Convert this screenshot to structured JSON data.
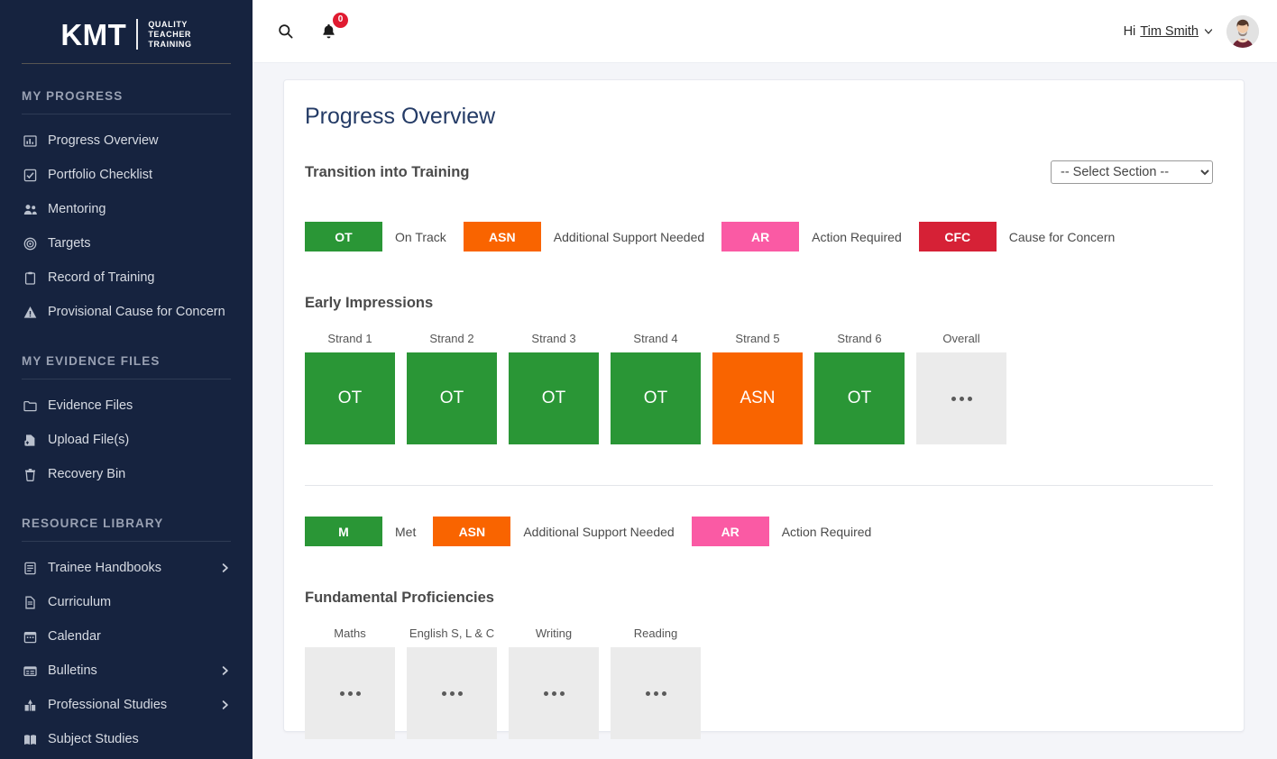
{
  "sidebar": {
    "logo": {
      "main": "KMT",
      "line1": "QUALITY",
      "line2": "TEACHER",
      "line3": "TRAINING"
    },
    "sections": [
      {
        "title": "MY PROGRESS",
        "items": [
          {
            "label": "Progress Overview",
            "icon": "bar-chart-icon",
            "chevron": false
          },
          {
            "label": "Portfolio Checklist",
            "icon": "checkbox-icon",
            "chevron": false
          },
          {
            "label": "Mentoring",
            "icon": "users-icon",
            "chevron": false
          },
          {
            "label": "Targets",
            "icon": "target-icon",
            "chevron": false
          },
          {
            "label": "Record of Training",
            "icon": "clipboard-icon",
            "chevron": false
          },
          {
            "label": "Provisional Cause for Concern",
            "icon": "warning-icon",
            "chevron": false
          }
        ]
      },
      {
        "title": "MY EVIDENCE FILES",
        "items": [
          {
            "label": "Evidence Files",
            "icon": "folder-icon",
            "chevron": false
          },
          {
            "label": "Upload File(s)",
            "icon": "file-upload-icon",
            "chevron": false
          },
          {
            "label": "Recovery Bin",
            "icon": "trash-icon",
            "chevron": false
          }
        ]
      },
      {
        "title": "RESOURCE LIBRARY",
        "items": [
          {
            "label": "Trainee Handbooks",
            "icon": "book-list-icon",
            "chevron": true
          },
          {
            "label": "Curriculum",
            "icon": "document-icon",
            "chevron": false
          },
          {
            "label": "Calendar",
            "icon": "calendar-icon",
            "chevron": false
          },
          {
            "label": "Bulletins",
            "icon": "table-icon",
            "chevron": true
          },
          {
            "label": "Professional Studies",
            "icon": "chalkboard-icon",
            "chevron": true
          },
          {
            "label": "Subject Studies",
            "icon": "open-book-icon",
            "chevron": false
          }
        ]
      }
    ]
  },
  "topbar": {
    "search_icon": "search-icon",
    "bell_icon": "bell-icon",
    "notification_count": "0",
    "greeting_prefix": "Hi",
    "user_name": "Tim Smith",
    "chevron_icon": "chevron-down-icon",
    "avatar": "user-avatar"
  },
  "main": {
    "page_title": "Progress Overview",
    "section_heading": "Transition into Training",
    "section_select": {
      "selected": "-- Select Section --",
      "options": [
        "-- Select Section --"
      ]
    },
    "legend_top": [
      {
        "code": "OT",
        "text": "On Track",
        "color": "#2a9636"
      },
      {
        "code": "ASN",
        "text": "Additional Support Needed",
        "color": "#f96400"
      },
      {
        "code": "AR",
        "text": "Action Required",
        "color": "#fa5aa4"
      },
      {
        "code": "CFC",
        "text": "Cause for Concern",
        "color": "#d62136"
      }
    ],
    "early_impressions": {
      "heading": "Early Impressions",
      "tiles": [
        {
          "label": "Strand 1",
          "value": "OT",
          "color": "#2a9636",
          "empty": false
        },
        {
          "label": "Strand 2",
          "value": "OT",
          "color": "#2a9636",
          "empty": false
        },
        {
          "label": "Strand 3",
          "value": "OT",
          "color": "#2a9636",
          "empty": false
        },
        {
          "label": "Strand 4",
          "value": "OT",
          "color": "#2a9636",
          "empty": false
        },
        {
          "label": "Strand 5",
          "value": "ASN",
          "color": "#f96400",
          "empty": false
        },
        {
          "label": "Strand 6",
          "value": "OT",
          "color": "#2a9636",
          "empty": false
        },
        {
          "label": "Overall",
          "value": "",
          "color": "#ebebeb",
          "empty": true
        }
      ]
    },
    "legend_bottom": [
      {
        "code": "M",
        "text": "Met",
        "color": "#2a9636"
      },
      {
        "code": "ASN",
        "text": "Additional Support Needed",
        "color": "#f96400"
      },
      {
        "code": "AR",
        "text": "Action Required",
        "color": "#fa5aa4"
      }
    ],
    "fundamental_proficiencies": {
      "heading": "Fundamental Proficiencies",
      "tiles": [
        {
          "label": "Maths",
          "value": "",
          "color": "#ebebeb",
          "empty": true
        },
        {
          "label": "English S, L & C",
          "value": "",
          "color": "#ebebeb",
          "empty": true
        },
        {
          "label": "Writing",
          "value": "",
          "color": "#ebebeb",
          "empty": true
        },
        {
          "label": "Reading",
          "value": "",
          "color": "#ebebeb",
          "empty": true
        }
      ]
    }
  }
}
